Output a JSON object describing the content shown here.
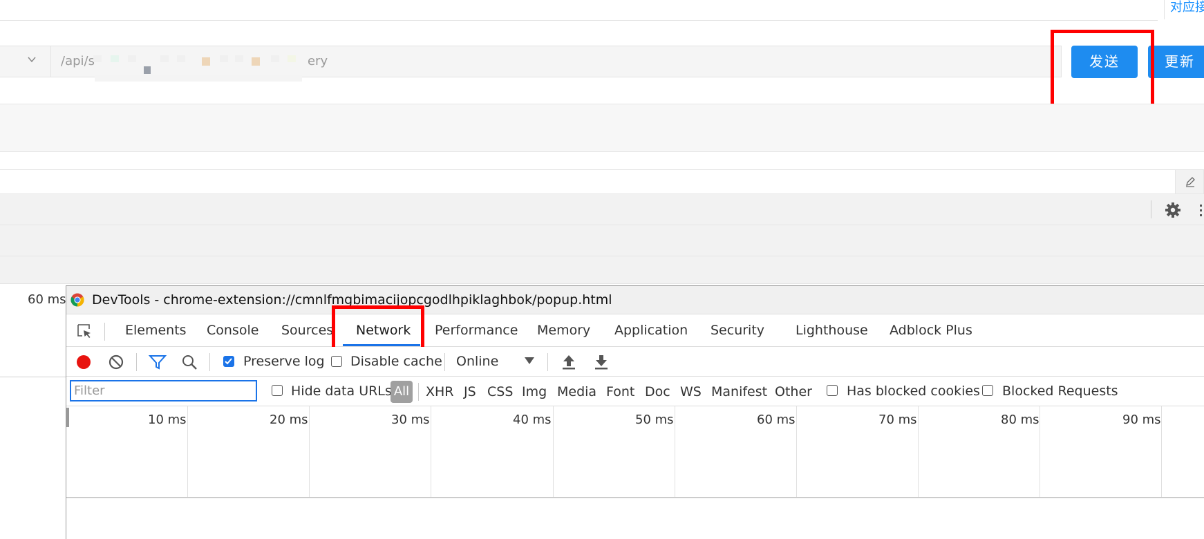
{
  "app": {
    "top_link": "对应接口",
    "url_value": "/api/s",
    "url_tail": "ery",
    "send_label": "发送",
    "update_label": "更新",
    "left_timing": "60 ms"
  },
  "devtools": {
    "title": "DevTools - chrome-extension://cmnlfmgbimacijopcgodlhpiklaghbok/popup.html",
    "tabs": [
      {
        "label": "Elements"
      },
      {
        "label": "Console"
      },
      {
        "label": "Sources"
      },
      {
        "label": "Network"
      },
      {
        "label": "Performance"
      },
      {
        "label": "Memory"
      },
      {
        "label": "Application"
      },
      {
        "label": "Security"
      },
      {
        "label": "Lighthouse"
      },
      {
        "label": "Adblock Plus"
      }
    ],
    "active_tab": "Network",
    "toolbar": {
      "preserve_log_label": "Preserve log",
      "preserve_log_checked": true,
      "disable_cache_label": "Disable cache",
      "disable_cache_checked": false,
      "throttle_value": "Online"
    },
    "filter": {
      "placeholder": "Filter",
      "hide_data_urls_label": "Hide data URLs",
      "all_label": "All",
      "types": [
        "XHR",
        "JS",
        "CSS",
        "Img",
        "Media",
        "Font",
        "Doc",
        "WS",
        "Manifest",
        "Other"
      ],
      "has_blocked_cookies_label": "Has blocked cookies",
      "blocked_requests_label": "Blocked Requests"
    },
    "timeline_ticks": [
      "10 ms",
      "20 ms",
      "30 ms",
      "40 ms",
      "50 ms",
      "60 ms",
      "70 ms",
      "80 ms",
      "90 ms"
    ]
  },
  "colors": {
    "accent": "#1e8cf0",
    "highlight": "#ff0000",
    "record": "#e8140f",
    "devtools_blue": "#1a73e8"
  },
  "icons": [
    "chevron-down-icon",
    "chrome-icon",
    "inspect-icon",
    "record-icon",
    "clear-icon",
    "filter-icon",
    "search-icon",
    "upload-icon",
    "download-icon",
    "gear-icon",
    "edit-icon"
  ]
}
